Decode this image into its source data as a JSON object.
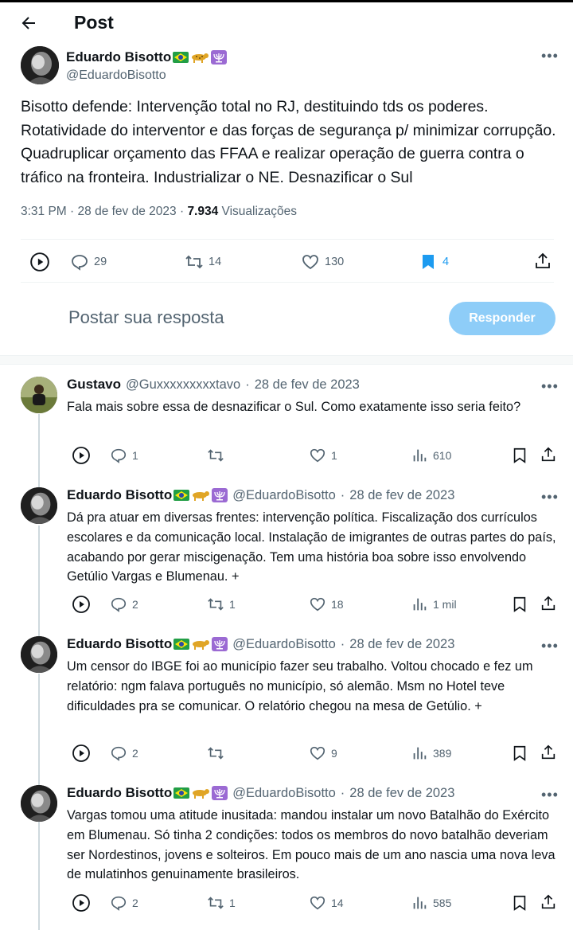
{
  "header": {
    "title": "Post"
  },
  "main": {
    "author": {
      "name": "Eduardo Bisotto",
      "handle": "@EduardoBisotto"
    },
    "text": "Bisotto defende: Intervenção total no RJ, destituindo tds os poderes. Rotatividade do interventor e das forças de segurança p/ minimizar corrupção. Quadruplicar orçamento das FFAA e realizar operação de guerra contra o tráfico na fronteira. Industrializar o NE. Desnazificar o Sul",
    "time": "3:31 PM",
    "date": "28 de fev de 2023",
    "views_count": "7.934",
    "views_label": "Visualizações",
    "stats": {
      "replies": "29",
      "reposts": "14",
      "likes": "130",
      "bookmarks": "4"
    }
  },
  "reply_box": {
    "placeholder": "Postar sua resposta",
    "button": "Responder"
  },
  "replies": [
    {
      "name": "Gustavo",
      "handle": "@Guxxxxxxxxxtavo",
      "date": "28 de fev de 2023",
      "text": "Fala mais sobre essa de desnazificar o Sul. Como exatamente isso seria feito?",
      "stats": {
        "replies": "1",
        "reposts": "",
        "likes": "1",
        "views": "610"
      }
    },
    {
      "name": "Eduardo Bisotto",
      "handle": "@EduardoBisotto",
      "date": "28 de fev de 2023",
      "text": "Dá pra atuar em diversas frentes: intervenção política. Fiscalização dos currículos escolares e da comunicação local. Instalação de imigrantes de outras partes do país, acabando por gerar miscigenação. Tem uma história boa sobre isso envolvendo Getúlio Vargas e Blumenau. +",
      "stats": {
        "replies": "2",
        "reposts": "1",
        "likes": "18",
        "views": "1 mil"
      }
    },
    {
      "name": "Eduardo Bisotto",
      "handle": "@EduardoBisotto",
      "date": "28 de fev de 2023",
      "text": "Um censor do IBGE foi ao município fazer seu trabalho. Voltou chocado e fez um relatório: ngm falava português no município, só alemão. Msm no Hotel teve dificuldades pra se comunicar. O relatório chegou na mesa de Getúlio. +",
      "stats": {
        "replies": "2",
        "reposts": "",
        "likes": "9",
        "views": "389"
      }
    },
    {
      "name": "Eduardo Bisotto",
      "handle": "@EduardoBisotto",
      "date": "28 de fev de 2023",
      "text": "Vargas tomou uma atitude inusitada: mandou instalar um novo Batalhão do Exército em Blumenau. Só tinha 2 condições: todos os membros do novo batalhão deveriam ser Nordestinos, jovens e solteiros. Em pouco mais de um ano nascia uma nova leva de mulatinhos genuinamente brasileiros.",
      "stats": {
        "replies": "2",
        "reposts": "1",
        "likes": "14",
        "views": "585"
      }
    }
  ],
  "separator": "·",
  "more_glyph": "•••",
  "icons": {
    "flag": "brazil-flag-icon",
    "leopard": "leopard-icon",
    "menorah": "menorah-icon"
  },
  "colors": {
    "accent": "#1d9bf0",
    "button_disabled": "#8ecdf8",
    "muted": "#536471"
  }
}
